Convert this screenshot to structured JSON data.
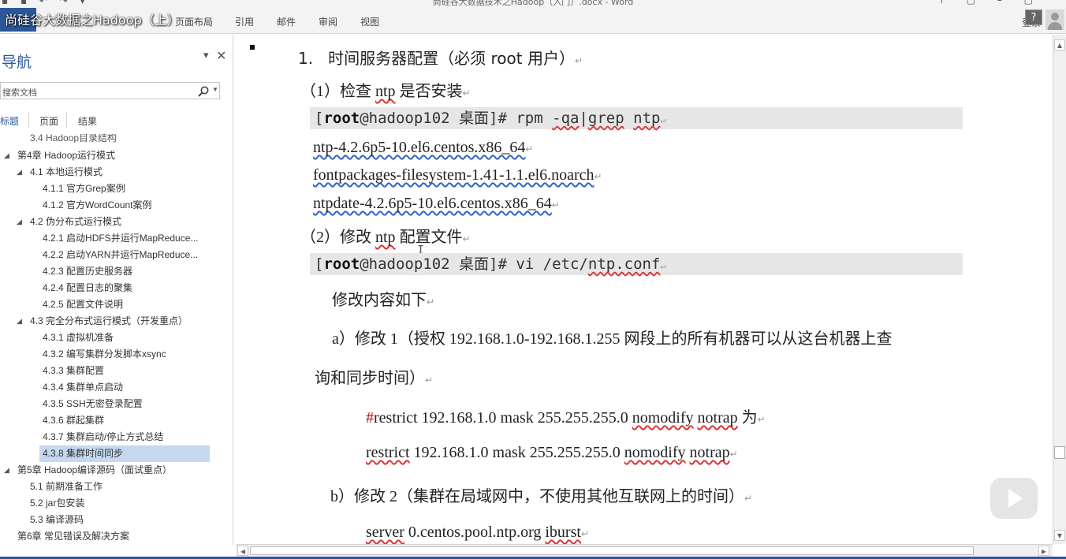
{
  "window": {
    "title": "尚硅谷大数据技术之Hadoop（入门）.docx - Word",
    "help": "?",
    "login": "登录"
  },
  "video_title": "尚硅谷大数据之Hadoop（上）",
  "ribbon_tabs": [
    "页面布局",
    "引用",
    "邮件",
    "审阅",
    "视图"
  ],
  "nav": {
    "title": "导航",
    "search_placeholder": "搜索文档",
    "tabs": [
      "标题",
      "页面",
      "结果"
    ],
    "items": [
      {
        "label": "3.4 Hadoop目录结构"
      },
      {
        "label": "第4章 Hadoop运行模式"
      },
      {
        "label": "4.1 本地运行模式"
      },
      {
        "label": "4.1.1 官方Grep案例"
      },
      {
        "label": "4.1.2 官方WordCount案例"
      },
      {
        "label": "4.2 伪分布式运行模式"
      },
      {
        "label": "4.2.1 启动HDFS并运行MapReduce..."
      },
      {
        "label": "4.2.2 启动YARN并运行MapReduce..."
      },
      {
        "label": "4.2.3 配置历史服务器"
      },
      {
        "label": "4.2.4 配置日志的聚集"
      },
      {
        "label": "4.2.5 配置文件说明"
      },
      {
        "label": "4.3 完全分布式运行模式（开发重点）"
      },
      {
        "label": "4.3.1 虚拟机准备"
      },
      {
        "label": "4.3.2 编写集群分发脚本xsync"
      },
      {
        "label": "4.3.3 集群配置"
      },
      {
        "label": "4.3.4 集群单点启动"
      },
      {
        "label": "4.3.5 SSH无密登录配置"
      },
      {
        "label": "4.3.6 群起集群"
      },
      {
        "label": "4.3.7 集群启动/停止方式总结"
      },
      {
        "label": "4.3.8 集群时间同步"
      },
      {
        "label": "第5章 Hadoop编译源码（面试重点）"
      },
      {
        "label": "5.1 前期准备工作"
      },
      {
        "label": "5.2 jar包安装"
      },
      {
        "label": "5.3 编译源码"
      },
      {
        "label": "第6章 常见错误及解决方案"
      }
    ]
  },
  "doc": {
    "heading_num": "1.",
    "heading": "时间服务器配置（必须 root 用户）",
    "step1": {
      "pre": "（1）检查 ",
      "ntp": "ntp",
      "post": " 是否安装"
    },
    "code1": {
      "root": "root",
      "host": "@hadoop102 桌面]# rpm ",
      "qa": "-qa",
      "mid": "|",
      "grep": "grep",
      "sp": " ",
      "ntp": "ntp"
    },
    "out1": "ntp-4.2.6p5-10.el6.centos.x86_64",
    "out2": "fontpackages-filesystem-1.41-1.1.el6.noarch",
    "out3": "ntpdate-4.2.6p5-10.el6.centos.x86_64",
    "step2": {
      "pre": "（2）修改 ",
      "ntp": "ntp",
      "post": " 配置文件"
    },
    "code2": {
      "root": "root",
      "host": "@hadoop102 桌面]# vi /etc/",
      "conf": "ntp.conf"
    },
    "modify": "修改内容如下",
    "a_line1": "a）修改 1（授权 192.168.1.0-192.168.1.255 网段上的所有机器可以从这台机器上查",
    "a_line2": "询和同步时间）",
    "restrict1": {
      "hash": "#",
      "text": "restrict 192.168.1.0 mask 255.255.255.0 ",
      "nomodify": "nomodify",
      "sp": " ",
      "notrap": "notrap",
      "post": " 为"
    },
    "restrict2": {
      "restrict": "restrict",
      "text": " 192.168.1.0 mask 255.255.255.0 ",
      "nomodify": "nomodify",
      "sp": " ",
      "notrap": "notrap"
    },
    "b_line": "b）修改 2（集群在局域网中，不使用其他互联网上的时间）",
    "server": {
      "server": "server",
      "text": " 0.centos.pool.ntp.org ",
      "iburst": "iburst"
    },
    "pilcrow": "↵",
    "cursor": "I"
  }
}
